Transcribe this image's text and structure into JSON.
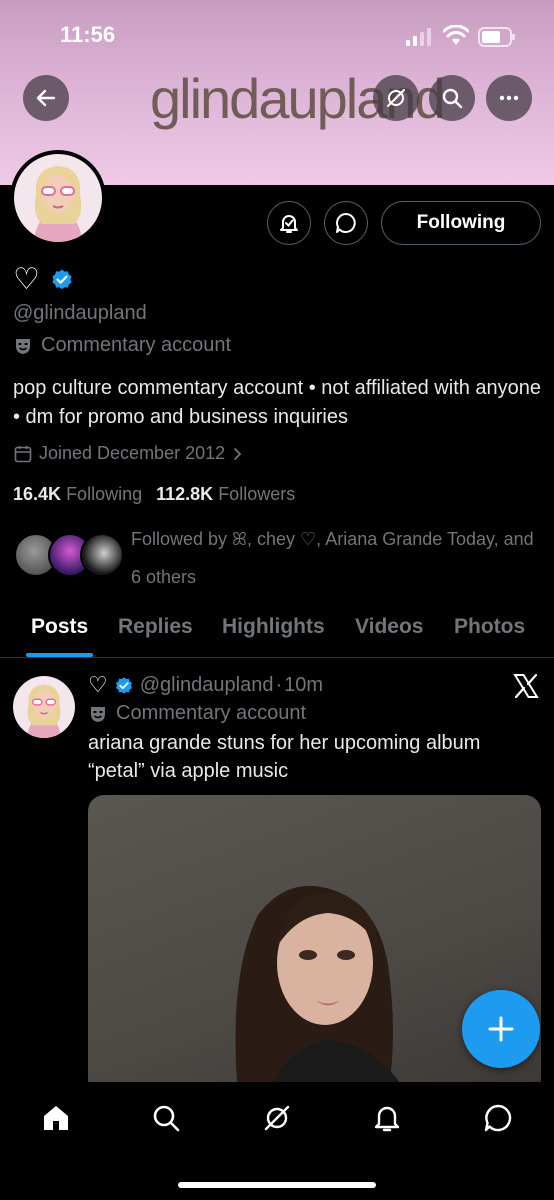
{
  "status_bar": {
    "time": "11:56"
  },
  "banner": {
    "text": "glindaupland"
  },
  "profile": {
    "follow_button_label": "Following",
    "display_name": "♡",
    "handle": "@glindaupland",
    "category": "Commentary account",
    "bio": "pop culture commentary account • not affiliated with anyone • dm for promo and business inquiries",
    "joined": "Joined December 2012",
    "following_count": "16.4K",
    "following_label": "Following",
    "followers_count": "112.8K",
    "followers_label": "Followers",
    "followed_by": "Followed by ꕤ, chey ♡, Ariana Grande Today, and 6 others"
  },
  "tabs": [
    "Posts",
    "Replies",
    "Highlights",
    "Videos",
    "Photos"
  ],
  "active_tab": "Posts",
  "post": {
    "display_name": "♡",
    "handle": "@glindaupland",
    "separator": "·",
    "time": "10m",
    "category": "Commentary account",
    "text": "ariana grande stuns for her upcoming album “petal” via apple music"
  },
  "colors": {
    "accent": "#1d9bf0",
    "muted": "#71767b",
    "banner": "#dcb3d6"
  },
  "icons": [
    "back-arrow-icon",
    "hide-icon",
    "search-icon",
    "more-icon",
    "notify-icon",
    "message-icon",
    "verified-icon",
    "theater-mask-icon",
    "calendar-icon",
    "chevron-right-icon",
    "x-logo-icon",
    "plus-icon",
    "home-icon",
    "explore-icon",
    "grok-icon",
    "bell-icon",
    "dm-icon"
  ]
}
